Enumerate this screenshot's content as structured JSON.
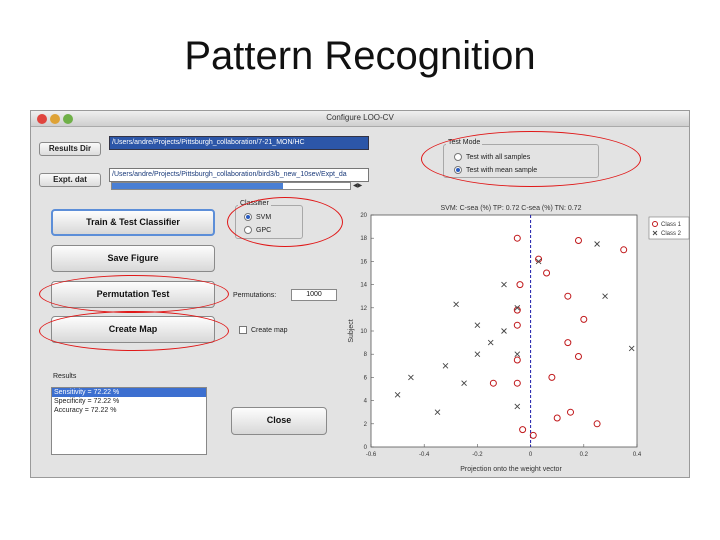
{
  "slide": {
    "title": "Pattern Recognition"
  },
  "window": {
    "title": "Configure LOO-CV"
  },
  "paths": {
    "results_dir_label": "Results Dir",
    "results_dir_value": "/Users/andre/Projects/Pittsburgh_collaboration/7-21_MON/HC",
    "expt_dat_label": "Expt. dat",
    "expt_dat_value": "/Users/andre/Projects/Pittsburgh_collaboration/bird3/b_new_10sev/Expt_da",
    "progress_fraction": 0.72
  },
  "test_mode": {
    "label": "Test Mode",
    "options": [
      {
        "label": "Test with all samples",
        "selected": false
      },
      {
        "label": "Test with mean sample",
        "selected": true
      }
    ]
  },
  "classifier": {
    "label": "Classifier",
    "options": [
      {
        "label": "SVM",
        "selected": true
      },
      {
        "label": "GPC",
        "selected": false
      }
    ]
  },
  "buttons": {
    "train": "Train & Test Classifier",
    "save": "Save Figure",
    "permutation": "Permutation Test",
    "create_map": "Create Map",
    "close": "Close"
  },
  "permutations": {
    "label": "Permutations:",
    "value": "1000"
  },
  "create_map_checkbox": {
    "label": "Create map",
    "checked": false
  },
  "results": {
    "label": "Results",
    "lines": [
      "Sensitivity = 72.22 %",
      "Specificity = 72.22 %",
      "Accuracy = 72.22 %"
    ],
    "selected_index": 0
  },
  "colors": {
    "accent": "#2a5bbf",
    "highlight_ellipse": "#e01818",
    "marker_class1": "#c0181b",
    "threshold_line": "#1b1baa"
  },
  "chart_data": {
    "type": "scatter",
    "title": "SVM: C-sea (%) TP: 0.72 C-sea (%) TN: 0.72",
    "xlabel": "Projection onto the weight vector",
    "ylabel": "Subject",
    "xlim": [
      -0.6,
      0.4
    ],
    "ylim": [
      0,
      20
    ],
    "xticks": [
      "-0.6",
      "-0.4",
      "-0.2",
      "0",
      "0.2",
      "0.4"
    ],
    "yticks": [
      "0",
      "2",
      "4",
      "6",
      "8",
      "10",
      "12",
      "14",
      "16",
      "18",
      "20"
    ],
    "threshold_x": 0,
    "grid": false,
    "legend_position": "top-right",
    "series": [
      {
        "name": "Class 1",
        "marker": "o",
        "points": [
          [
            -0.05,
            18
          ],
          [
            0.18,
            17.8
          ],
          [
            0.35,
            17
          ],
          [
            0.03,
            16.2
          ],
          [
            0.06,
            15
          ],
          [
            -0.04,
            14
          ],
          [
            0.14,
            13
          ],
          [
            -0.05,
            11.8
          ],
          [
            0.2,
            11
          ],
          [
            -0.05,
            10.5
          ],
          [
            0.14,
            9
          ],
          [
            0.18,
            7.8
          ],
          [
            -0.05,
            7.5
          ],
          [
            0.08,
            6
          ],
          [
            -0.05,
            5.5
          ],
          [
            -0.14,
            5.5
          ],
          [
            0.15,
            3
          ],
          [
            0.1,
            2.5
          ],
          [
            0.25,
            2
          ],
          [
            -0.03,
            1.5
          ],
          [
            0.01,
            1
          ]
        ]
      },
      {
        "name": "Class 2",
        "marker": "x",
        "points": [
          [
            0.25,
            17.5
          ],
          [
            0.03,
            16
          ],
          [
            -0.1,
            14
          ],
          [
            0.28,
            13
          ],
          [
            -0.28,
            12.3
          ],
          [
            -0.05,
            12
          ],
          [
            -0.2,
            10.5
          ],
          [
            -0.1,
            10
          ],
          [
            -0.15,
            9
          ],
          [
            -0.2,
            8
          ],
          [
            -0.05,
            8
          ],
          [
            -0.32,
            7
          ],
          [
            -0.45,
            6
          ],
          [
            -0.25,
            5.5
          ],
          [
            -0.5,
            4.5
          ],
          [
            -0.35,
            3
          ],
          [
            -0.05,
            3.5
          ],
          [
            0.38,
            8.5
          ]
        ]
      }
    ]
  }
}
